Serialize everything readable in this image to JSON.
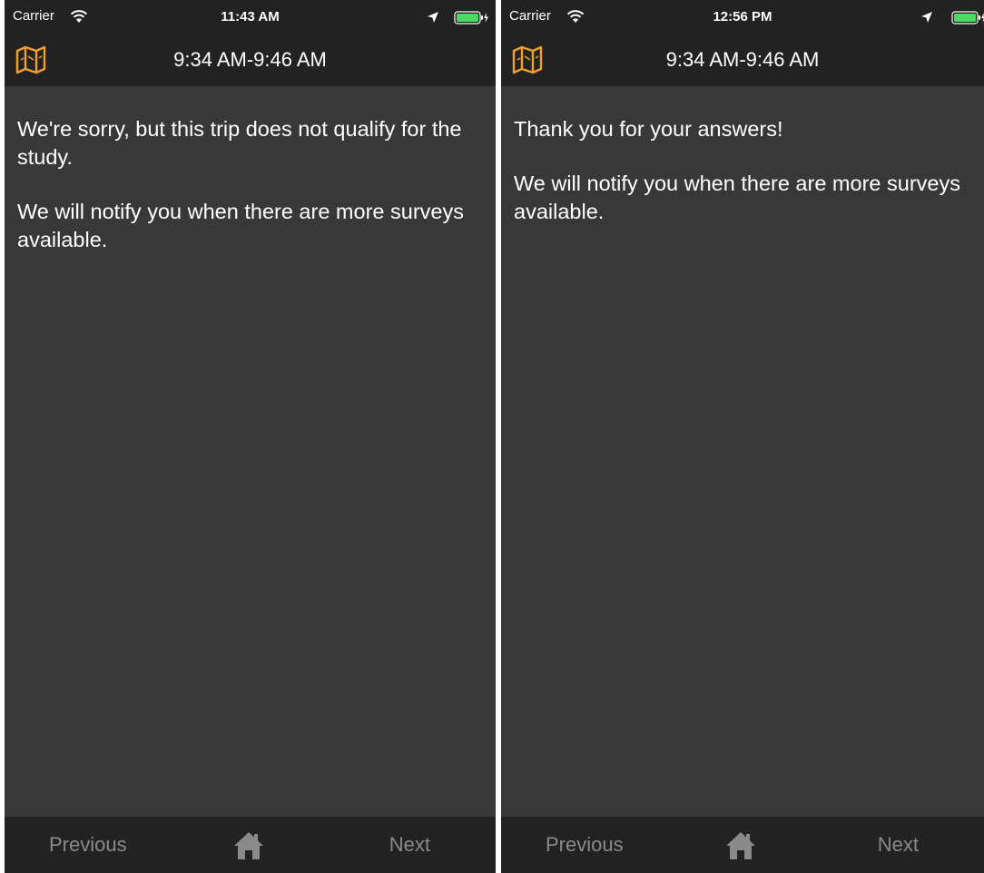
{
  "screens": [
    {
      "status": {
        "carrier": "Carrier",
        "time": "11:43 AM"
      },
      "nav": {
        "title": "9:34 AM-9:46 AM"
      },
      "messages": [
        "We're sorry, but this trip does not qualify for the study.",
        "We will notify you when there are more surveys available."
      ],
      "tabbar": {
        "previous": "Previous",
        "next": "Next"
      }
    },
    {
      "status": {
        "carrier": "Carrier",
        "time": "12:56 PM"
      },
      "nav": {
        "title": "9:34 AM-9:46 AM"
      },
      "messages": [
        "Thank you for your answers!",
        "We will notify you when there are more surveys available."
      ],
      "tabbar": {
        "previous": "Previous",
        "next": "Next"
      }
    }
  ],
  "colors": {
    "accent": "#f0a030",
    "battery": "#4cd964",
    "background": "#383838",
    "bar": "#222222",
    "inactive_text": "#8a8a8a"
  },
  "icons": {
    "map": "folded-map-icon",
    "home": "house-icon",
    "wifi": "wifi-icon",
    "location": "location-arrow-icon",
    "battery": "battery-charging-icon"
  }
}
